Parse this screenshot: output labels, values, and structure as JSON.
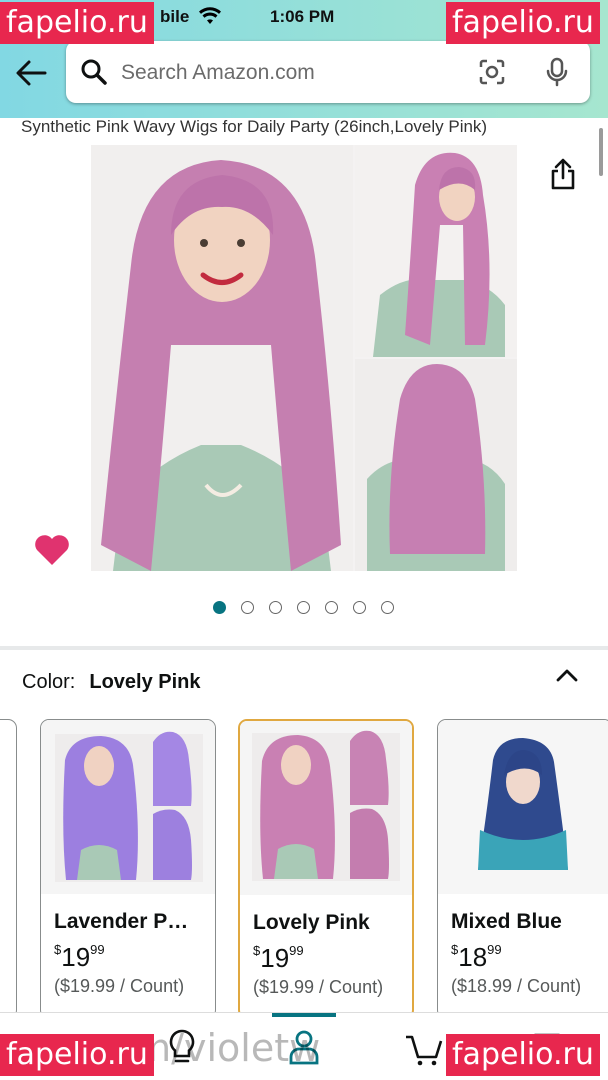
{
  "status_bar": {
    "carrier": "bile",
    "time": "1:06 PM",
    "right": "7"
  },
  "search": {
    "placeholder": "Search Amazon.com"
  },
  "product": {
    "title": "Synthetic Pink Wavy Wigs for Daily Party (26inch,Lovely Pink)",
    "image_count": 7,
    "active_image_index": 0
  },
  "color_selector": {
    "label": "Color:",
    "selected": "Lovely Pink"
  },
  "swatches": [
    {
      "name": "Lavender P…",
      "price_currency": "$",
      "price_dollars": "19",
      "price_cents": "99",
      "unit_price": "($19.99 / Count)",
      "selected": false
    },
    {
      "name": "Lovely Pink",
      "price_currency": "$",
      "price_dollars": "19",
      "price_cents": "99",
      "unit_price": "($19.99 / Count)",
      "selected": true
    },
    {
      "name": "Mixed Blue",
      "price_currency": "$",
      "price_dollars": "18",
      "price_cents": "99",
      "unit_price": "($18.99 / Count)",
      "selected": false
    }
  ],
  "watermarks": {
    "brand": "fapelio.ru",
    "url_fragment": "com/violetw"
  },
  "colors": {
    "accent_teal": "#087481",
    "heart_pink": "#e0336f",
    "selected_border": "#e0a840",
    "watermark_red": "#e8274e"
  },
  "icons": [
    "back-arrow-icon",
    "search-icon",
    "camera-scan-icon",
    "microphone-icon",
    "share-icon",
    "heart-icon",
    "chevron-up-icon",
    "lightbulb-icon",
    "account-icon",
    "cart-icon",
    "menu-icon"
  ]
}
